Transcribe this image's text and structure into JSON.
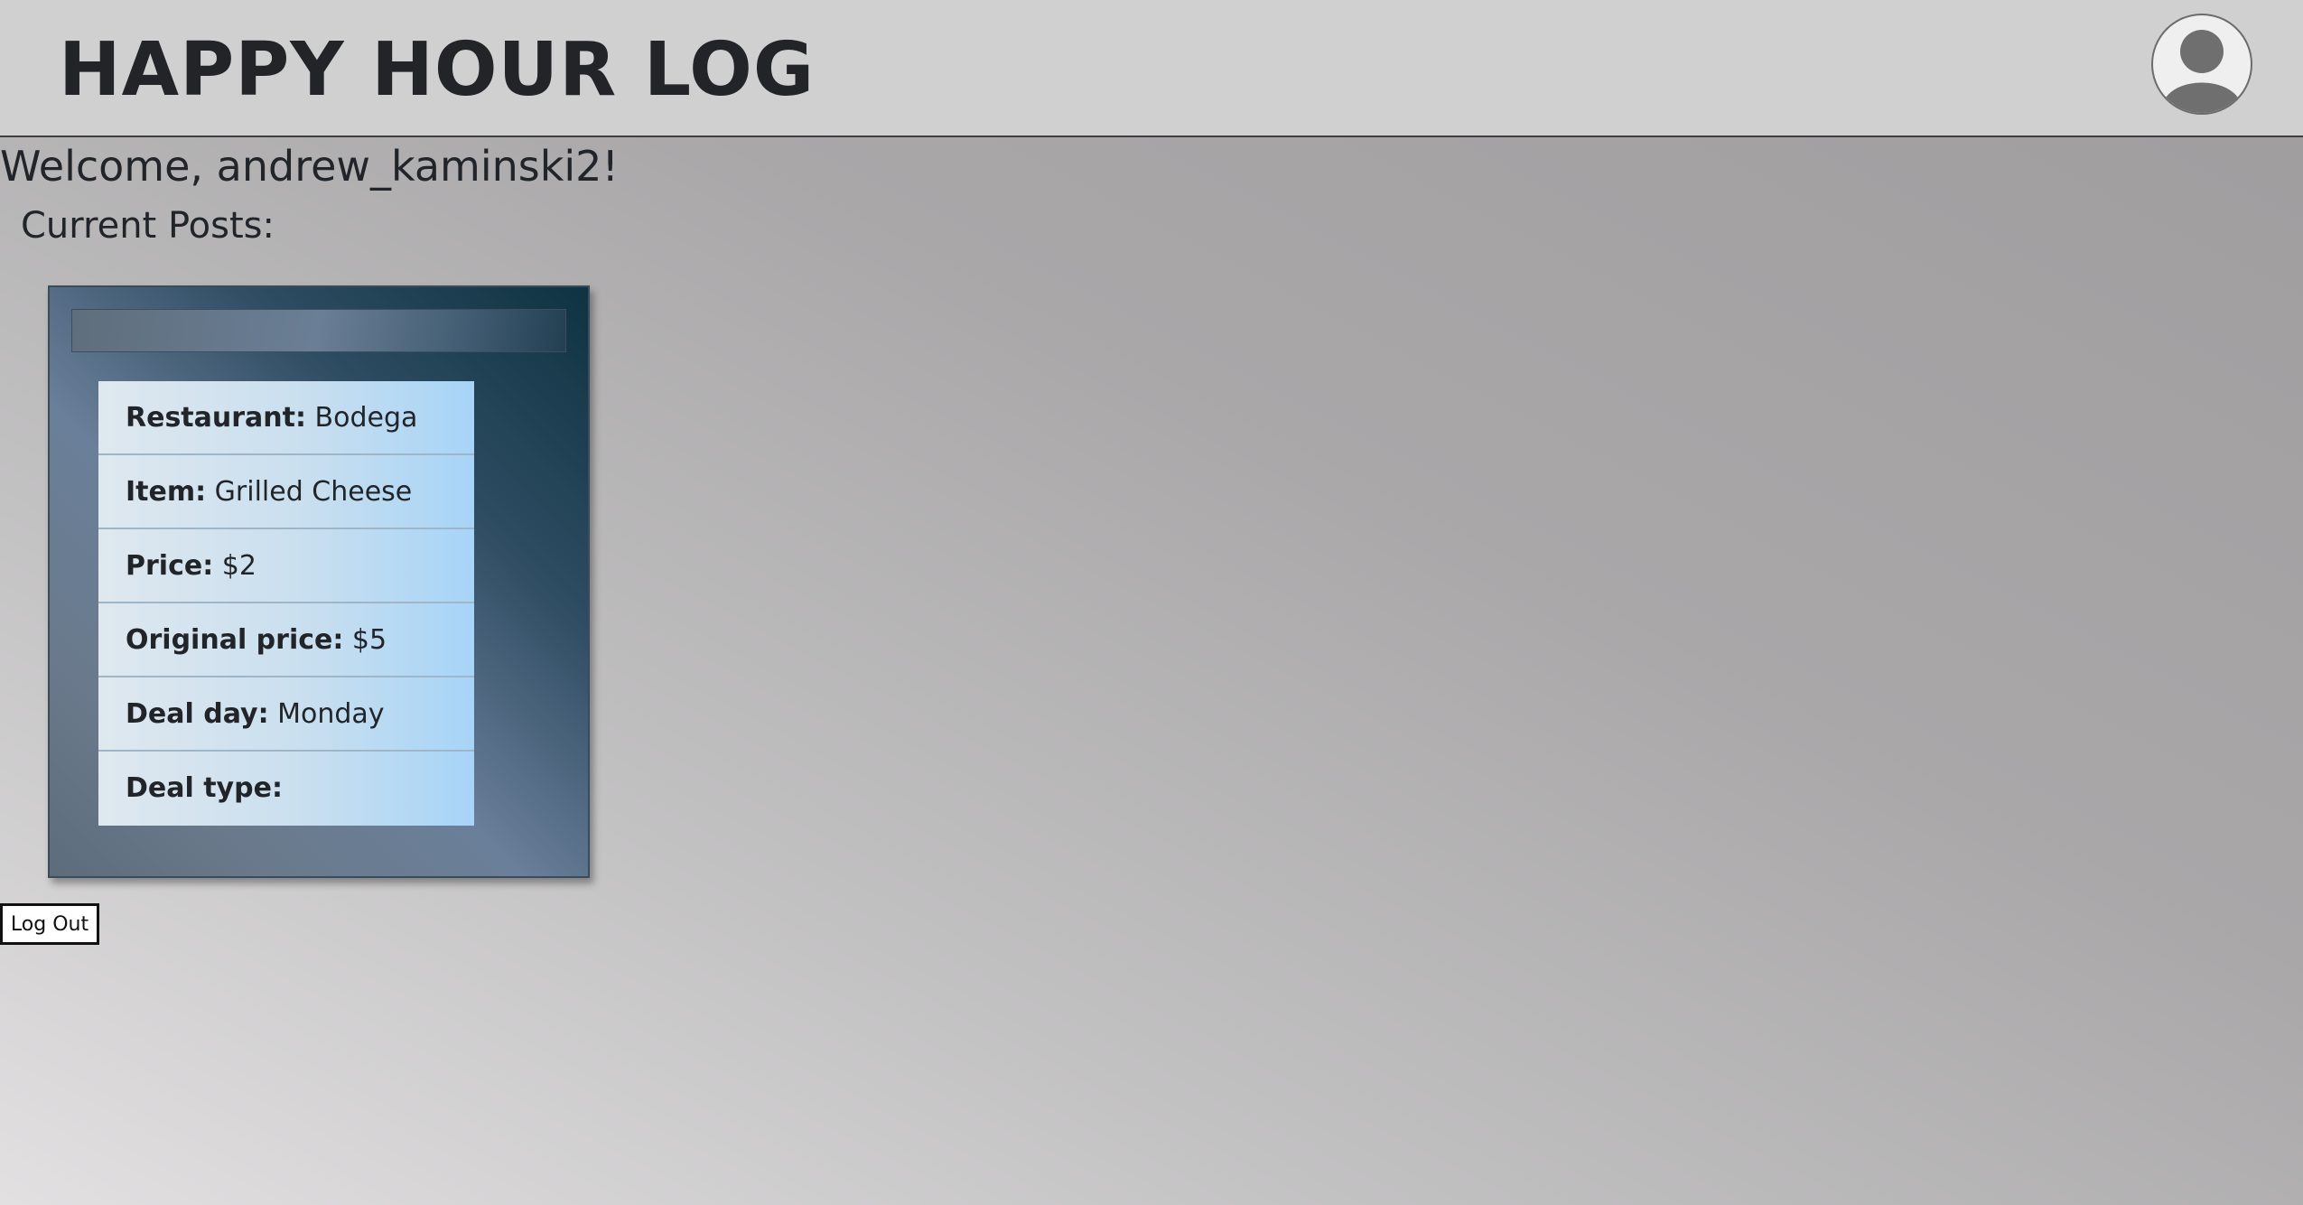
{
  "header": {
    "title": "HAPPY HOUR LOG",
    "avatar_icon": "user-avatar-icon"
  },
  "welcome": {
    "text": "Welcome, andrew_kaminski2!"
  },
  "posts": {
    "heading": "Current Posts:",
    "items": [
      {
        "fields": [
          {
            "label": "Restaurant:",
            "value": "Bodega"
          },
          {
            "label": "Item:",
            "value": "Grilled Cheese"
          },
          {
            "label": "Price:",
            "value": "$2"
          },
          {
            "label": "Original price:",
            "value": "$5"
          },
          {
            "label": "Deal day:",
            "value": "Monday"
          },
          {
            "label": "Deal type:",
            "value": ""
          }
        ]
      }
    ]
  },
  "actions": {
    "logout_label": "Log Out"
  },
  "colors": {
    "header_bg": "#d0d0d0",
    "card_dark": "#0f3342",
    "row_light_blue": "#a7d4f7"
  }
}
